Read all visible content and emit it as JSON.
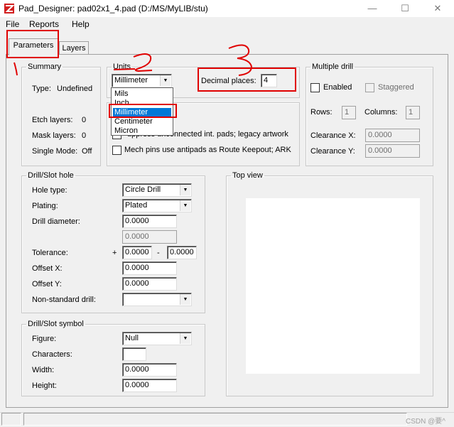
{
  "window": {
    "title": "Pad_Designer: pad02x1_4.pad (D:/MS/MyLIB/stu)"
  },
  "menu": [
    "File",
    "Reports",
    "Help"
  ],
  "tabs": [
    {
      "label": "Parameters",
      "active": true
    },
    {
      "label": "Layers",
      "active": false
    }
  ],
  "summary": {
    "legend": "Summary",
    "type_label": "Type:",
    "type_value": "Undefined",
    "etch_label": "Etch layers:",
    "etch_value": "0",
    "mask_label": "Mask layers:",
    "mask_value": "0",
    "single_label": "Single Mode:",
    "single_value": "Off"
  },
  "units": {
    "legend": "Units",
    "selected": "Millimeter",
    "options": [
      "Mils",
      "Inch",
      "Millimeter",
      "Centimeter",
      "Micron"
    ],
    "decimal_label": "Decimal places:",
    "decimal_value": "4"
  },
  "options": {
    "suppress_label": "Suppress unconnected int. pads; legacy artwork",
    "suppress_visible": "uppress unconnected int. pads; legacy artwork",
    "mech_label": "Mech pins use antipads as Route Keepout; ARK"
  },
  "multiple_drill": {
    "legend": "Multiple drill",
    "enabled_label": "Enabled",
    "staggered_label": "Staggered",
    "rows_label": "Rows:",
    "rows_value": "1",
    "columns_label": "Columns:",
    "columns_value": "1",
    "clearance_x_label": "Clearance X:",
    "clearance_x_value": "0.0000",
    "clearance_y_label": "Clearance Y:",
    "clearance_y_value": "0.0000"
  },
  "drill": {
    "legend": "Drill/Slot hole",
    "hole_type_label": "Hole type:",
    "hole_type_value": "Circle Drill",
    "plating_label": "Plating:",
    "plating_value": "Plated",
    "diameter_label": "Drill diameter:",
    "diameter_value": "0.0000",
    "diameter2_value": "0.0000",
    "tolerance_label": "Tolerance:",
    "tol_plus": "+",
    "tol_plus_value": "0.0000",
    "tol_minus": "-",
    "tol_minus_value": "0.0000",
    "offset_x_label": "Offset X:",
    "offset_x_value": "0.0000",
    "offset_y_label": "Offset Y:",
    "offset_y_value": "0.0000",
    "nonstd_label": "Non-standard drill:",
    "nonstd_value": ""
  },
  "symbol": {
    "legend": "Drill/Slot symbol",
    "figure_label": "Figure:",
    "figure_value": "Null",
    "characters_label": "Characters:",
    "characters_value": "",
    "width_label": "Width:",
    "width_value": "0.0000",
    "height_label": "Height:",
    "height_value": "0.0000"
  },
  "topview": {
    "legend": "Top view"
  },
  "annotations": [
    "1",
    "2",
    "3"
  ],
  "watermark": "CSDN @要^",
  "colors": {
    "accent": "#0078d7",
    "annotation": "#e00000",
    "panel": "#f0f0f0"
  }
}
